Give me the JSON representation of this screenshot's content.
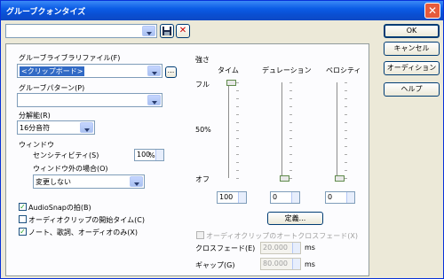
{
  "window": {
    "title": "グルーブクォンタイズ",
    "close_glyph": "✕"
  },
  "preset": {
    "value": "",
    "save_icon": "floppy-icon",
    "delete_icon": "delete-x-icon",
    "delete_glyph": "✕"
  },
  "buttons": {
    "ok": "OK",
    "cancel": "キャンセル",
    "audition": "オーディション",
    "help": "ヘルプ",
    "define": "定義..."
  },
  "groove_file": {
    "label": "グルーブライブラリファイル(F)",
    "value": "<クリップボード>",
    "browse": "..."
  },
  "groove_pattern": {
    "label": "グルーブパターン(P)",
    "value": ""
  },
  "resolution": {
    "label": "分解能(R)",
    "value": "16分音符"
  },
  "window_group": {
    "label": "ウィンドウ",
    "sensitivity_label": "センシティビティ(S)",
    "sensitivity_value": "100",
    "sensitivity_unit": "%",
    "outside_label": "ウィンドウ外の場合(O)",
    "outside_value": "変更しない"
  },
  "checkboxes": [
    {
      "label": "AudioSnapの拍(B)",
      "checked": true
    },
    {
      "label": "オーディオクリップの開始タイム(C)",
      "checked": false
    },
    {
      "label": "ノート、歌詞、オーディオのみ(X)",
      "checked": true
    }
  ],
  "strength": {
    "label": "強さ",
    "scale": {
      "full": "フル",
      "half": "50%",
      "off": "オフ"
    },
    "columns": [
      {
        "label": "タイム",
        "value": "100",
        "level": 100
      },
      {
        "label": "デュレーション",
        "value": "0",
        "level": 0
      },
      {
        "label": "ベロシティ",
        "value": "0",
        "level": 0
      }
    ]
  },
  "crossfade": {
    "auto_label": "オーディオクリップのオートクロスフェード(X)",
    "auto_checked": false,
    "crossfade_label": "クロスフェード(E)",
    "crossfade_value": "20.000",
    "gap_label": "ギャップ(G)",
    "gap_value": "80.000",
    "unit": "ms"
  }
}
